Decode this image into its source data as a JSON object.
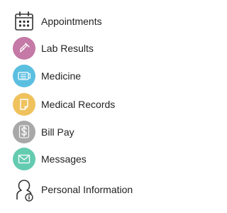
{
  "menu": {
    "items": [
      {
        "label": "Appointments",
        "icon": "calendar-icon",
        "color": ""
      },
      {
        "label": "Lab Results",
        "icon": "test-tube-icon",
        "color": "#c479a6"
      },
      {
        "label": "Medicine",
        "icon": "pill-bottle-icon",
        "color": "#5bbfe0"
      },
      {
        "label": "Medical Records",
        "icon": "document-icon",
        "color": "#efc25e"
      },
      {
        "label": "Bill Pay",
        "icon": "dollar-icon",
        "color": "#a8a8a8"
      },
      {
        "label": "Messages",
        "icon": "envelope-icon",
        "color": "#63cbb0"
      },
      {
        "label": "Personal Information",
        "icon": "person-info-icon",
        "color": ""
      }
    ]
  }
}
